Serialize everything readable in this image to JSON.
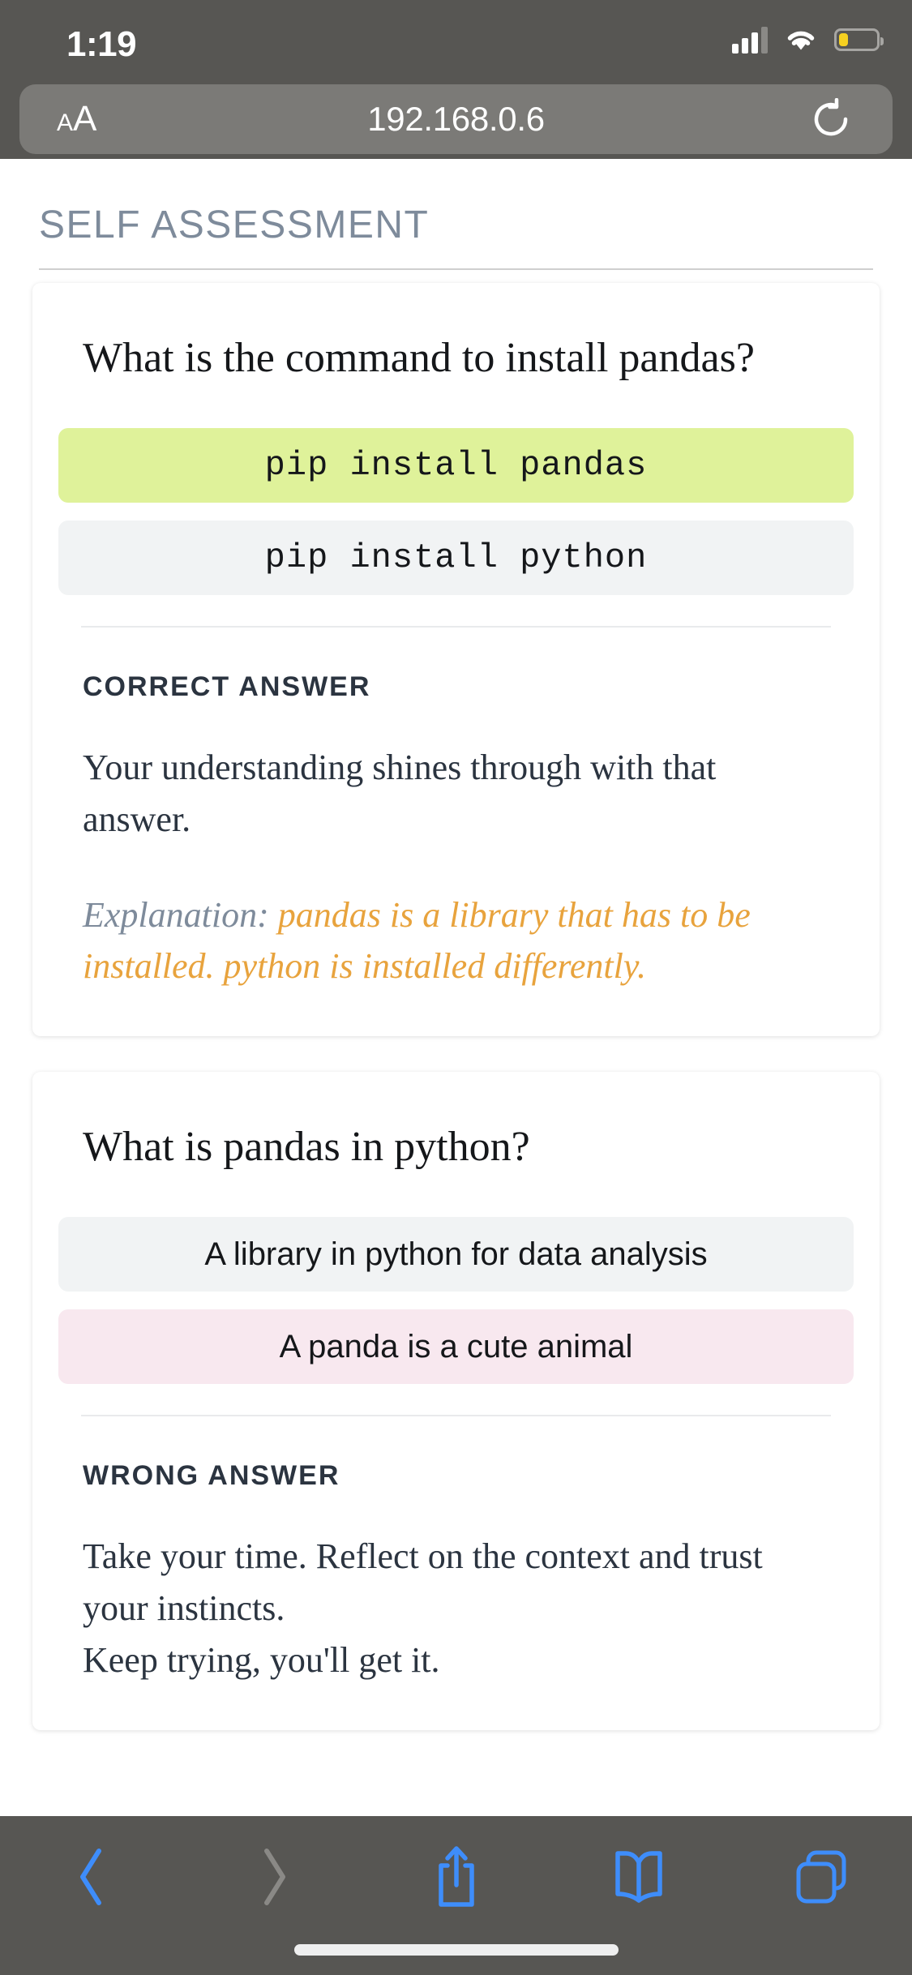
{
  "status_bar": {
    "time": "1:19",
    "signal_icon": "cellular-signal-icon",
    "wifi_icon": "wifi-icon",
    "battery_icon": "battery-low-icon",
    "battery_color": "#f5d020"
  },
  "browser": {
    "text_size_small": "A",
    "text_size_large": "A",
    "url": "192.168.0.6",
    "reload_icon": "reload-icon"
  },
  "page": {
    "section_title": "SELF ASSESSMENT",
    "section_title_color": "#7e8b9b",
    "cards": [
      {
        "question": "What is the command to install pandas?",
        "option_style": "mono",
        "options": [
          {
            "text": "pip install pandas",
            "state": "correct"
          },
          {
            "text": "pip install python",
            "state": "neutral"
          }
        ],
        "verdict": "CORRECT ANSWER",
        "feedback": "Your understanding shines through with that answer.",
        "explanation_label": "Explanation:",
        "explanation_text": "pandas is a library that has to be installed. python is installed differently."
      },
      {
        "question": "What is pandas in python?",
        "option_style": "sans",
        "options": [
          {
            "text": "A library in python for data analysis",
            "state": "neutral"
          },
          {
            "text": "A panda is a cute animal",
            "state": "wrong"
          }
        ],
        "verdict": "WRONG ANSWER",
        "feedback": "Take your time. Reflect on the context and trust your instincts.",
        "feedback_extra": "Keep trying, you'll get it."
      }
    ],
    "colors": {
      "correct_option_bg": "#dff29a",
      "wrong_option_bg": "#f8e8ef",
      "neutral_option_bg": "#f1f3f4",
      "explanation_accent": "#e8a33d"
    }
  },
  "toolbar": {
    "back_icon": "back-chevron-icon",
    "forward_icon": "forward-chevron-icon",
    "share_icon": "share-icon",
    "bookmarks_icon": "bookmarks-icon",
    "tabs_icon": "tabs-icon",
    "accent_color": "#3e8dfb",
    "disabled_color": "#8a8986",
    "home_indicator": "home-indicator"
  }
}
